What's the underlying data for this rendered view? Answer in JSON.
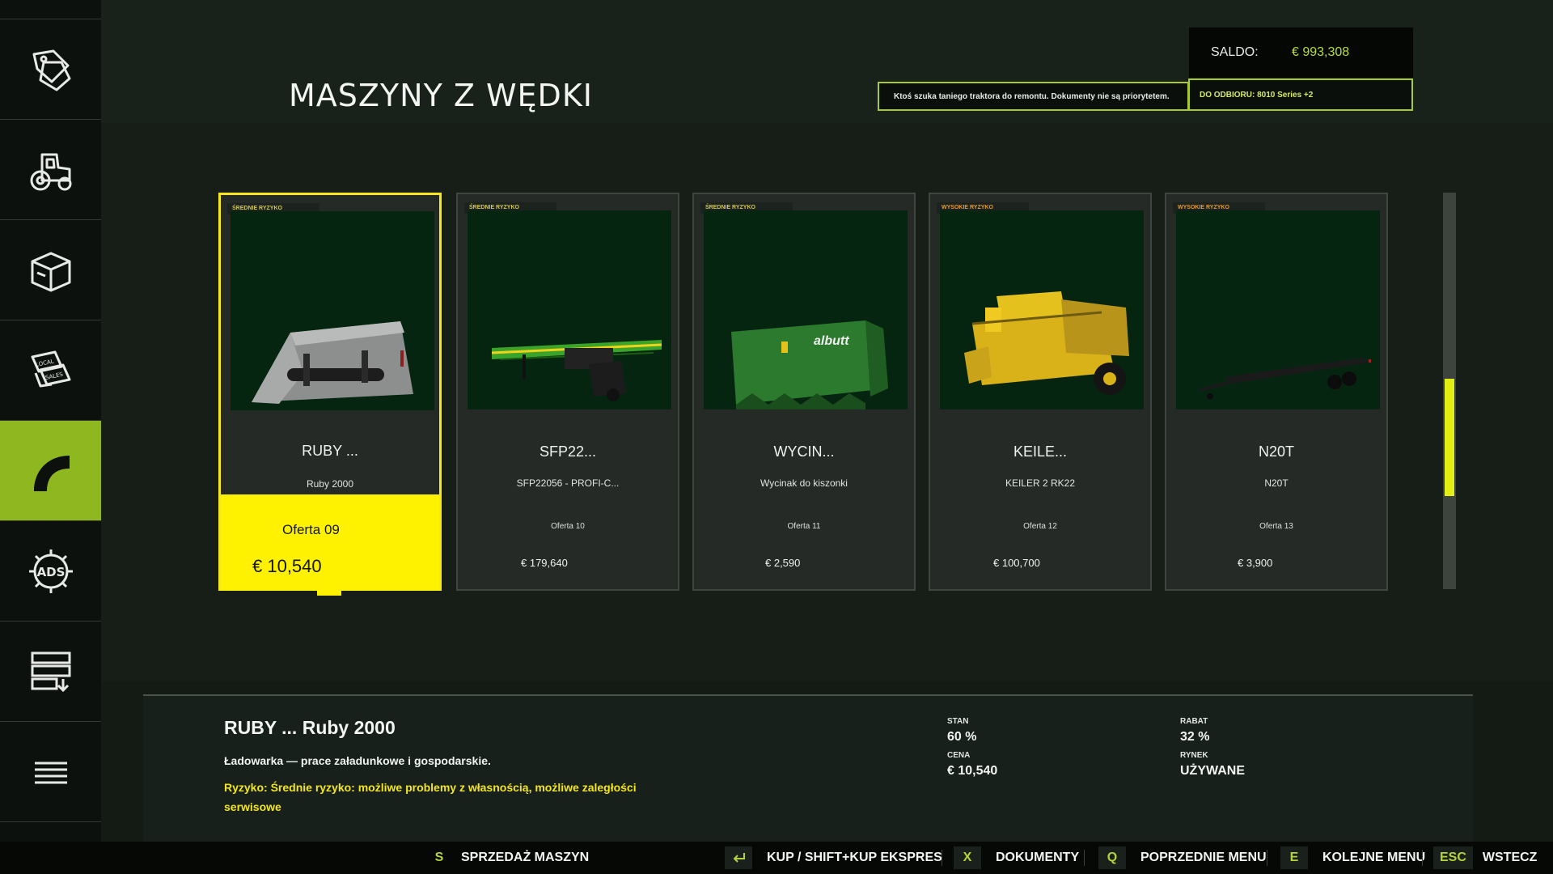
{
  "page_title": "MASZYNY Z WĘDKI",
  "header": {
    "saldo_label": "SALDO:",
    "saldo_value": "€ 993,308",
    "ticker": "Ktoś szuka taniego traktora do remontu. Dokumenty nie są priorytetem.",
    "pickup": "DO ODBIORU: 8010 Series +2"
  },
  "sidebar": {
    "items": [
      {
        "icon": "price-tags-icon"
      },
      {
        "icon": "tractor-icon"
      },
      {
        "icon": "box-icon"
      },
      {
        "icon": "local-sales-icon"
      },
      {
        "icon": "gauge-icon",
        "active": true
      },
      {
        "icon": "ads-gear-icon"
      },
      {
        "icon": "server-download-icon"
      },
      {
        "icon": "menu-icon"
      }
    ]
  },
  "cards": [
    {
      "risk": "ŚREDNIE RYZYKO",
      "name": "RUBY ...",
      "sub": "Ruby 2000",
      "offer": "Oferta 09",
      "price": "€ 10,540",
      "image": "shovel-bucket-image",
      "selected": true
    },
    {
      "risk": "ŚREDNIE RYZYKO",
      "name": "SFP22...",
      "sub": "SFP22056 - PROFI-C...",
      "offer": "Oferta 10",
      "price": "€ 179,640",
      "image": "sprayer-boom-image"
    },
    {
      "risk": "ŚREDNIE RYZYKO",
      "name": "WYCIN...",
      "sub": "Wycinak do kiszonki",
      "offer": "Oferta 11",
      "price": "€ 2,590",
      "image": "silage-cutter-image"
    },
    {
      "risk": "WYSOKIE RYZYKO",
      "name": "KEILE...",
      "sub": "KEILER 2 RK22",
      "offer": "Oferta 12",
      "price": "€ 100,700",
      "image": "potato-harvester-image"
    },
    {
      "risk": "WYSOKIE RYZYKO",
      "name": "N20T",
      "sub": "N20T",
      "offer": "Oferta 13",
      "price": "€ 3,900",
      "image": "flatbed-trailer-image"
    }
  ],
  "details": {
    "title": "RUBY ... Ruby 2000",
    "description": "Ładowarka — prace załadunkowe i gospodarskie.",
    "risk_text": "Ryzyko: Średnie ryzyko: możliwe problemy z własnością, możliwe zaległości serwisowe",
    "stats": {
      "stan_label": "STAN",
      "stan_value": "60 %",
      "cena_label": "CENA",
      "cena_value": "€ 10,540",
      "rabat_label": "RABAT",
      "rabat_value": "32 %",
      "rynek_label": "RYNEK",
      "rynek_value": "UŻYWANE"
    }
  },
  "bottombar": {
    "sell_key": "S",
    "sell_label": "SPRZEDAŻ MASZYN",
    "buy_key_icon": "enter-key-icon",
    "buy_label": "KUP / SHIFT+KUP EKSPRES",
    "docs_key": "X",
    "docs_label": "DOKUMENTY",
    "prev_key": "Q",
    "prev_label": "POPRZEDNIE MENU",
    "next_key": "E",
    "next_label": "KOLEJNE MENU",
    "back_key": "ESC",
    "back_label": "WSTECZ"
  },
  "colors": {
    "accent_green": "#8fb820",
    "selection_yellow": "#fff200",
    "scroll_thumb": "#e2ef14"
  }
}
